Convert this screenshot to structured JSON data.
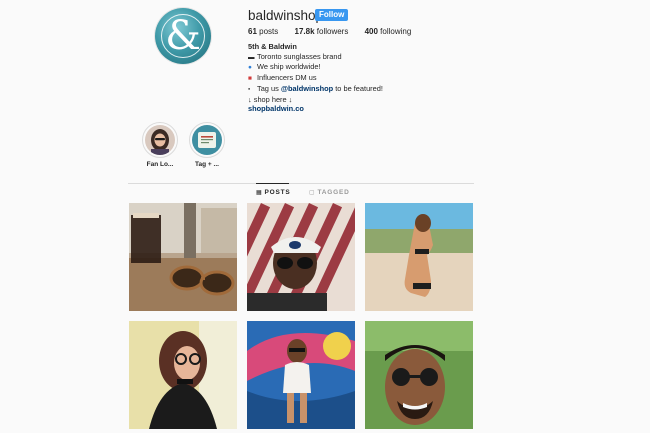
{
  "profile": {
    "username": "baldwinshop",
    "follow_label": "Follow",
    "avatar_glyph": "&",
    "stats": [
      {
        "value": "61",
        "label": "posts"
      },
      {
        "value": "17.8k",
        "label": "followers"
      },
      {
        "value": "400",
        "label": "following"
      }
    ],
    "bio": {
      "name": "5th & Baldwin",
      "line1_icon": "sunglasses-emoji",
      "line1": "Toronto sunglasses brand",
      "line2_icon": "globe-emoji",
      "line2": "We ship worldwide!",
      "line3_icon": "mailbox-emoji",
      "line3": "Influencers DM us",
      "line4_icon": "camera-emoji",
      "line4_pre": "Tag us ",
      "line4_mention": "@baldwinshop",
      "line4_post": " to be featured!",
      "line5": "↓ shop here ↓",
      "link": "shopbaldwin.co"
    }
  },
  "highlights": [
    {
      "label": "Fan Lo...",
      "icon": "woman-portrait"
    },
    {
      "label": "Tag + ...",
      "icon": "tag-graphic"
    }
  ],
  "tabs": [
    {
      "label": "POSTS",
      "icon": "grid-icon",
      "active": true
    },
    {
      "label": "TAGGED",
      "icon": "tag-icon",
      "active": false
    }
  ],
  "posts": [
    {
      "subject": "sunglasses-on-cafe-table"
    },
    {
      "subject": "man-with-cap-and-sunglasses"
    },
    {
      "subject": "woman-on-beach"
    },
    {
      "subject": "woman-with-round-glasses"
    },
    {
      "subject": "woman-at-graffiti-wall"
    },
    {
      "subject": "smiling-man-in-sunglasses"
    }
  ],
  "colors": {
    "accent": "#3897f0",
    "link": "#003569",
    "background": "#fafafa",
    "text": "#262626"
  }
}
